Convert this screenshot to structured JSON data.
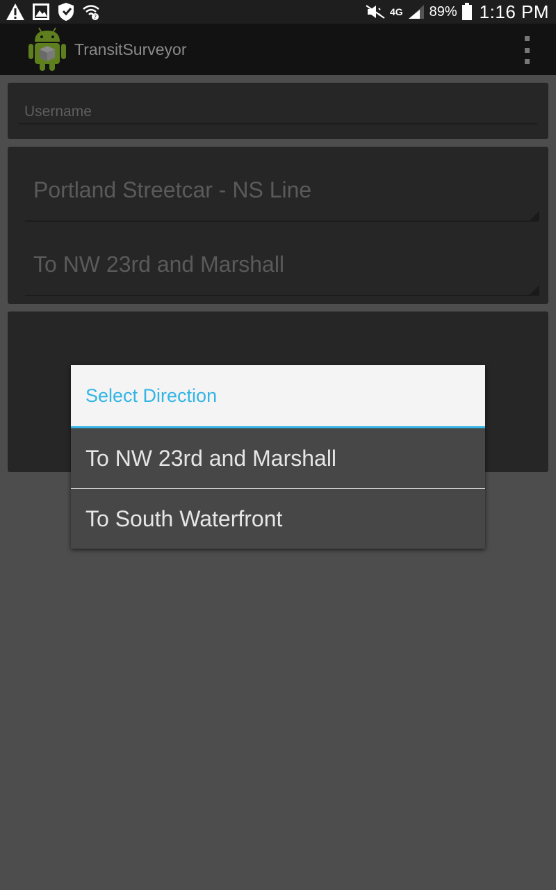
{
  "status_bar": {
    "icons_left": [
      "warning-icon",
      "gallery-icon",
      "shield-icon",
      "wifi-icon"
    ],
    "icons_right": [
      "mute-icon",
      "4g-icon",
      "signal-icon"
    ],
    "network": "4G",
    "battery_percent": "89%",
    "time": "1:16 PM"
  },
  "action_bar": {
    "title": "TransitSurveyor",
    "menu_icon": "overflow-menu-icon"
  },
  "form": {
    "username_placeholder": "Username",
    "route_value": "Portland Streetcar - NS Line",
    "direction_value": "To NW 23rd and Marshall"
  },
  "dialog": {
    "title": "Select Direction",
    "options": [
      "To NW 23rd and Marshall",
      "To South Waterfront"
    ]
  },
  "colors": {
    "accent": "#33b5e5",
    "background": "#4d4d4d",
    "card": "#262626",
    "action_bar": "#121212"
  }
}
